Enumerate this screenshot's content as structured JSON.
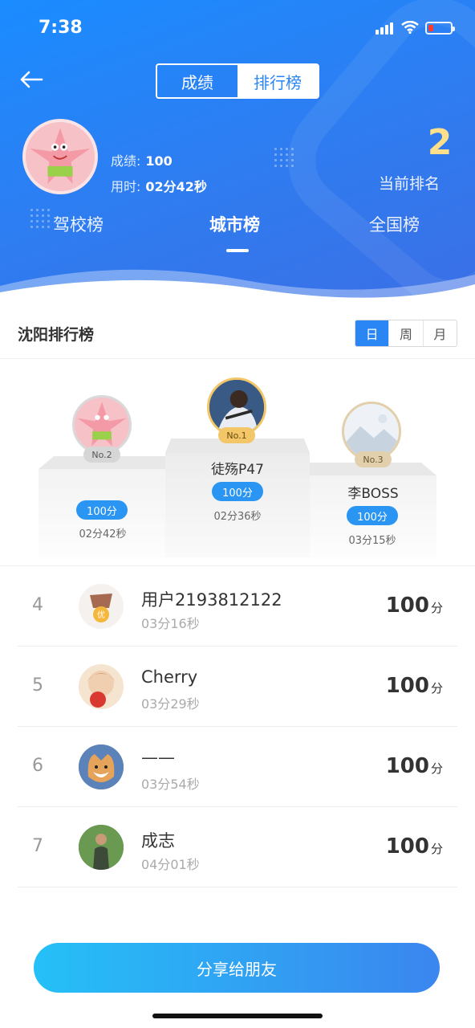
{
  "status_bar": {
    "time": "7:38"
  },
  "header": {
    "segments": [
      "成绩",
      "排行榜"
    ],
    "active_segment": 1,
    "my_score_label": "成绩:",
    "my_score": "100",
    "my_time_label": "用时:",
    "my_time": "02分42秒",
    "current_rank": "2",
    "current_rank_label": "当前排名",
    "tabs": [
      "驾校榜",
      "城市榜",
      "全国榜"
    ],
    "active_tab": 1
  },
  "section": {
    "title": "沈阳排行榜",
    "periods": [
      "日",
      "周",
      "月"
    ],
    "active_period": 0
  },
  "podium": {
    "first": {
      "badge": "No.1",
      "name": "徒殇P47",
      "score": "100分",
      "time": "02分36秒"
    },
    "second": {
      "badge": "No.2",
      "score": "100分",
      "time": "02分42秒"
    },
    "third": {
      "badge": "No.3",
      "name": "李BOSS",
      "score": "100分",
      "time": "03分15秒"
    }
  },
  "list": [
    {
      "rank": "4",
      "name": "用户2193812122",
      "time": "03分16秒",
      "score": "100",
      "unit": "分"
    },
    {
      "rank": "5",
      "name": "Cherry",
      "time": "03分29秒",
      "score": "100",
      "unit": "分"
    },
    {
      "rank": "6",
      "name": "——",
      "time": "03分54秒",
      "score": "100",
      "unit": "分"
    },
    {
      "rank": "7",
      "name": "成志",
      "time": "04分01秒",
      "score": "100",
      "unit": "分"
    }
  ],
  "share_button": "分享给朋友",
  "colors": {
    "brand_blue": "#2b86f5",
    "score_pill": "#2b95f3",
    "rank_gold": "#ffe08a"
  }
}
